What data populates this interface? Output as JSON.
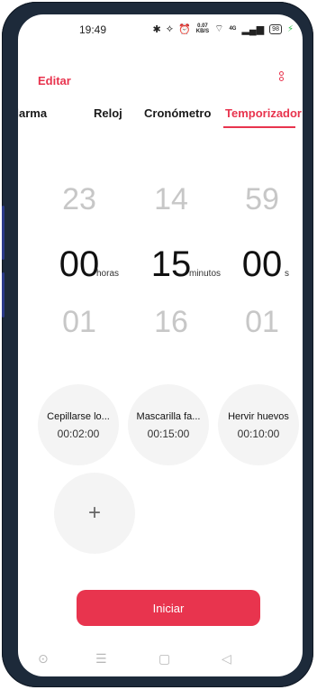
{
  "status_bar": {
    "time": "19:49",
    "speed_value": "0.07",
    "speed_unit": "KB/S",
    "sim_label": "4G",
    "battery": "98"
  },
  "header": {
    "edit_label": "Editar",
    "more_icon": "vertical-dots"
  },
  "tabs": [
    {
      "label": "Alarma",
      "active": false
    },
    {
      "label": "Reloj",
      "active": false
    },
    {
      "label": "Cronómetro",
      "active": false
    },
    {
      "label": "Temporizador",
      "active": true
    }
  ],
  "picker": {
    "hours": {
      "prev": "23",
      "current": "00",
      "next": "01",
      "unit": "horas"
    },
    "minutes": {
      "prev": "14",
      "current": "15",
      "next": "16",
      "unit": "minutos"
    },
    "seconds": {
      "prev": "59",
      "current": "00",
      "next": "01",
      "unit": "s"
    }
  },
  "presets": [
    {
      "name": "Cepillarse lo...",
      "time": "00:02:00"
    },
    {
      "name": "Mascarilla fa...",
      "time": "00:15:00"
    },
    {
      "name": "Hervir huevos",
      "time": "00:10:00"
    }
  ],
  "add_preset_symbol": "+",
  "start_label": "Iniciar",
  "colors": {
    "accent": "#e8344e",
    "bezel": "#1d2a3a"
  }
}
